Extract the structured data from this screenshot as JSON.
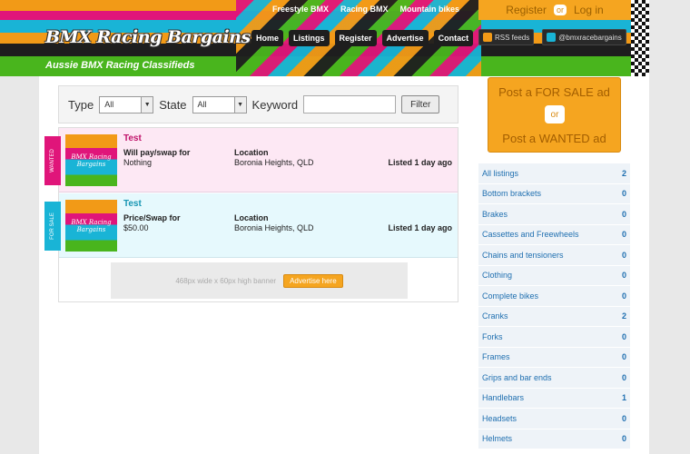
{
  "header": {
    "logo": "BMX Racing Bargains",
    "tagline": "Aussie BMX Racing Classifieds",
    "top_links": [
      "Freestyle BMX",
      "Racing BMX",
      "Mountain bikes"
    ],
    "nav": [
      "Home",
      "Listings",
      "Register",
      "Advertise",
      "Contact"
    ],
    "auth": {
      "register": "Register",
      "or": "or",
      "login": "Log in"
    },
    "social": {
      "rss": "RSS feeds",
      "twitter": "@bmxracebargains"
    }
  },
  "filter": {
    "type_label": "Type",
    "type_value": "All",
    "state_label": "State",
    "state_value": "All",
    "keyword_label": "Keyword",
    "keyword_value": "",
    "button": "Filter"
  },
  "listings": [
    {
      "tab": "WANTED",
      "title": "Test",
      "label1": "Will pay/swap for",
      "value1": "Nothing",
      "label2": "Location",
      "value2": "Boronia Heights, QLD",
      "listed": "Listed 1 day ago",
      "thumb": "BMX Racing Bargains"
    },
    {
      "tab": "FOR SALE",
      "title": "Test",
      "label1": "Price/Swap for",
      "value1": "$50.00",
      "label2": "Location",
      "value2": "Boronia Heights, QLD",
      "listed": "Listed 1 day ago",
      "thumb": "BMX Racing Bargains"
    }
  ],
  "banner": {
    "text": "468px wide x 60px high banner",
    "button": "Advertise here"
  },
  "sidebar": {
    "post_sale": "Post a FOR SALE ad",
    "or": "or",
    "post_wanted": "Post a WANTED ad",
    "categories": [
      {
        "name": "All listings",
        "count": "2"
      },
      {
        "name": "Bottom brackets",
        "count": "0"
      },
      {
        "name": "Brakes",
        "count": "0"
      },
      {
        "name": "Cassettes and Freewheels",
        "count": "0"
      },
      {
        "name": "Chains and tensioners",
        "count": "0"
      },
      {
        "name": "Clothing",
        "count": "0"
      },
      {
        "name": "Complete bikes",
        "count": "0"
      },
      {
        "name": "Cranks",
        "count": "2"
      },
      {
        "name": "Forks",
        "count": "0"
      },
      {
        "name": "Frames",
        "count": "0"
      },
      {
        "name": "Grips and bar ends",
        "count": "0"
      },
      {
        "name": "Handlebars",
        "count": "1"
      },
      {
        "name": "Headsets",
        "count": "0"
      },
      {
        "name": "Helmets",
        "count": "0"
      }
    ]
  },
  "colors": {
    "orange": "#f29a17",
    "pink": "#e0157a",
    "cyan": "#19b4d6",
    "green": "#49b51d",
    "dark": "#1e1e1e",
    "link": "#1f6fb0"
  }
}
